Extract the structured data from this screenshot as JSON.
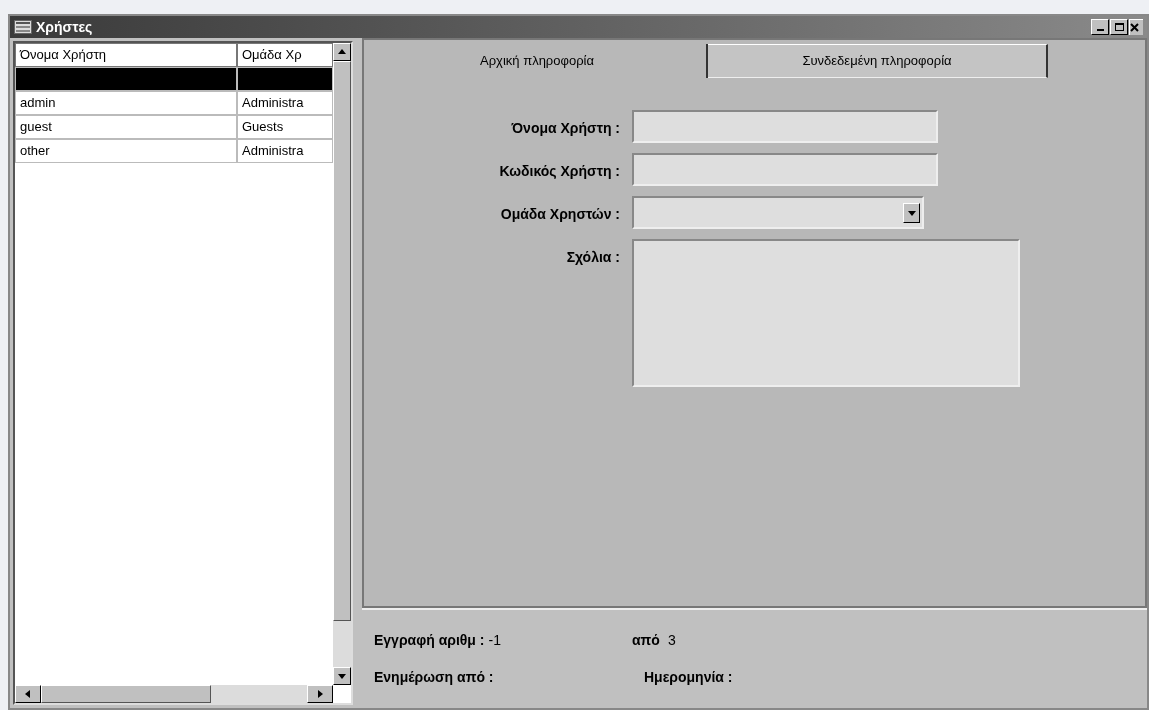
{
  "window": {
    "title": "Χρήστες"
  },
  "list": {
    "columns": [
      "Όνομα Χρήστη",
      "Ομάδα Χρ"
    ],
    "rows": [
      {
        "cells": [
          "",
          ""
        ],
        "selected": true
      },
      {
        "cells": [
          "admin",
          "Administra"
        ],
        "selected": false
      },
      {
        "cells": [
          "guest",
          "Guests"
        ],
        "selected": false
      },
      {
        "cells": [
          "other",
          "Administra"
        ],
        "selected": false
      }
    ]
  },
  "tabs": [
    {
      "label": "Αρχική πληροφορία",
      "selected": true
    },
    {
      "label": "Συνδεδεμένη πληροφορία",
      "selected": false
    }
  ],
  "form": [
    {
      "kind": "text",
      "label": "Όνομα Χρήστη :"
    },
    {
      "kind": "text",
      "label": "Κωδικός Χρήστη :"
    },
    {
      "kind": "select",
      "label": "Ομάδα Χρηστών :"
    },
    {
      "kind": "textarea",
      "label": "Σχόλια :"
    }
  ],
  "status": {
    "record_label": "Εγγραφή αριθμ :",
    "record_value": "-1",
    "of_label": "από",
    "of_value": "3",
    "updated_by_label": "Ενημέρωση από :",
    "date_label": "Ημερομηνία :"
  }
}
